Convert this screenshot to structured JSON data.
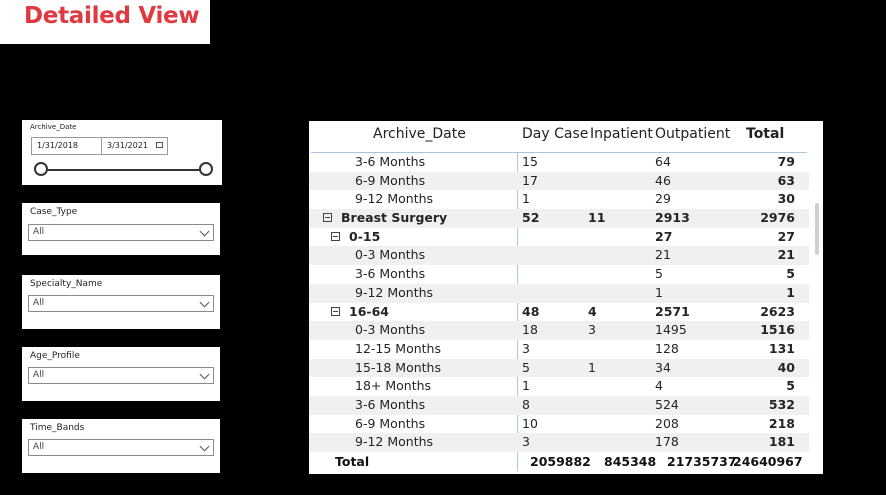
{
  "page_title": "Detailed View",
  "slicers": {
    "archive_date": {
      "label": "Archive_Date",
      "start": "1/31/2018",
      "end": "3/31/2021"
    },
    "case_type": {
      "label": "Case_Type",
      "value": "All"
    },
    "specialty_name": {
      "label": "Specialty_Name",
      "value": "All"
    },
    "age_profile": {
      "label": "Age_Profile",
      "value": "All"
    },
    "time_bands": {
      "label": "Time_Bands",
      "value": "All"
    }
  },
  "matrix": {
    "headers": {
      "label": "Archive_Date",
      "day_case": "Day Case",
      "inpatient": "Inpatient",
      "outpatient": "Outpatient",
      "total": "Total"
    },
    "rows": [
      {
        "label": "3-6 Months",
        "day": "15",
        "inp": "",
        "out": "64",
        "total": "79"
      },
      {
        "label": "6-9 Months",
        "day": "17",
        "inp": "",
        "out": "46",
        "total": "63"
      },
      {
        "label": "9-12 Months",
        "day": "1",
        "inp": "",
        "out": "29",
        "total": "30"
      },
      {
        "label": "Breast Surgery",
        "day": "52",
        "inp": "11",
        "out": "2913",
        "total": "2976"
      },
      {
        "label": "0-15",
        "day": "",
        "inp": "",
        "out": "27",
        "total": "27"
      },
      {
        "label": "0-3 Months",
        "day": "",
        "inp": "",
        "out": "21",
        "total": "21"
      },
      {
        "label": "3-6 Months",
        "day": "",
        "inp": "",
        "out": "5",
        "total": "5"
      },
      {
        "label": "9-12 Months",
        "day": "",
        "inp": "",
        "out": "1",
        "total": "1"
      },
      {
        "label": "16-64",
        "day": "48",
        "inp": "4",
        "out": "2571",
        "total": "2623"
      },
      {
        "label": "0-3 Months",
        "day": "18",
        "inp": "3",
        "out": "1495",
        "total": "1516"
      },
      {
        "label": "12-15 Months",
        "day": "3",
        "inp": "",
        "out": "128",
        "total": "131"
      },
      {
        "label": "15-18 Months",
        "day": "5",
        "inp": "1",
        "out": "34",
        "total": "40"
      },
      {
        "label": "18+ Months",
        "day": "1",
        "inp": "",
        "out": "4",
        "total": "5"
      },
      {
        "label": "3-6 Months",
        "day": "8",
        "inp": "",
        "out": "524",
        "total": "532"
      },
      {
        "label": "6-9 Months",
        "day": "10",
        "inp": "",
        "out": "208",
        "total": "218"
      },
      {
        "label": "9-12 Months",
        "day": "3",
        "inp": "",
        "out": "178",
        "total": "181"
      }
    ],
    "total": {
      "label": "Total",
      "day": "2059882",
      "inp": "845348",
      "out": "21735737",
      "total": "24640967"
    }
  }
}
